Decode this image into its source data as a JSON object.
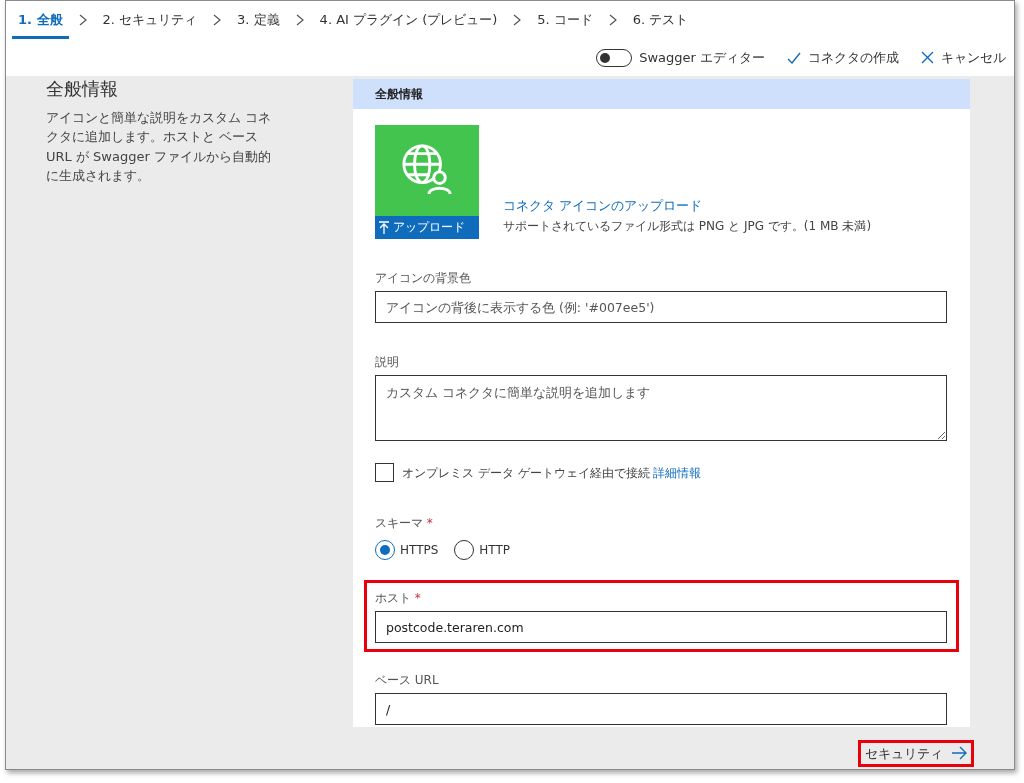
{
  "tabs": [
    {
      "label": "1. 全般",
      "selected": true
    },
    {
      "label": "2. セキュリティ",
      "selected": false
    },
    {
      "label": "3. 定義",
      "selected": false
    },
    {
      "label": "4. AI プラグイン (プレビュー)",
      "selected": false
    },
    {
      "label": "5. コード",
      "selected": false
    },
    {
      "label": "6. テスト",
      "selected": false
    }
  ],
  "toolbar": {
    "swagger_toggle": {
      "label": "Swagger エディター",
      "on": false
    },
    "create_button": "コネクタの作成",
    "cancel_button": "キャンセル"
  },
  "intro": {
    "title": "全般情報",
    "description": "アイコンと簡単な説明をカスタム コネクタに追加します。ホストと ベース URL が Swagger ファイルから自動的に生成されます。"
  },
  "card": {
    "header": "全般情報",
    "upload_button": "アップロード",
    "upload_link": "コネクタ アイコンのアップロード",
    "upload_note": "サポートされているファイル形式は PNG と JPG です。(1 MB 未満)",
    "fields": [
      {
        "kind": "input",
        "label": "アイコンの背景色",
        "placeholder": "アイコンの背後に表示する色 (例: '#007ee5')"
      },
      {
        "kind": "textarea",
        "label": "説明",
        "placeholder": "カスタム コネクタに簡単な説明を追加します"
      }
    ],
    "gateway": {
      "label": "オンプレミス データ ゲートウェイ経由で接続",
      "link": "詳細情報",
      "checked": false
    },
    "scheme": {
      "label": "スキーマ",
      "required_mark": "*",
      "options": [
        {
          "label": "HTTPS",
          "selected": true
        },
        {
          "label": "HTTP",
          "selected": false
        }
      ]
    },
    "host": {
      "label": "ホスト",
      "required_mark": "*",
      "value": "postcode.teraren.com",
      "highlighted": true
    },
    "base_url": {
      "label": "ベース URL",
      "value": "/"
    }
  },
  "next_button": {
    "label": "セキュリティ",
    "highlighted": true
  }
}
